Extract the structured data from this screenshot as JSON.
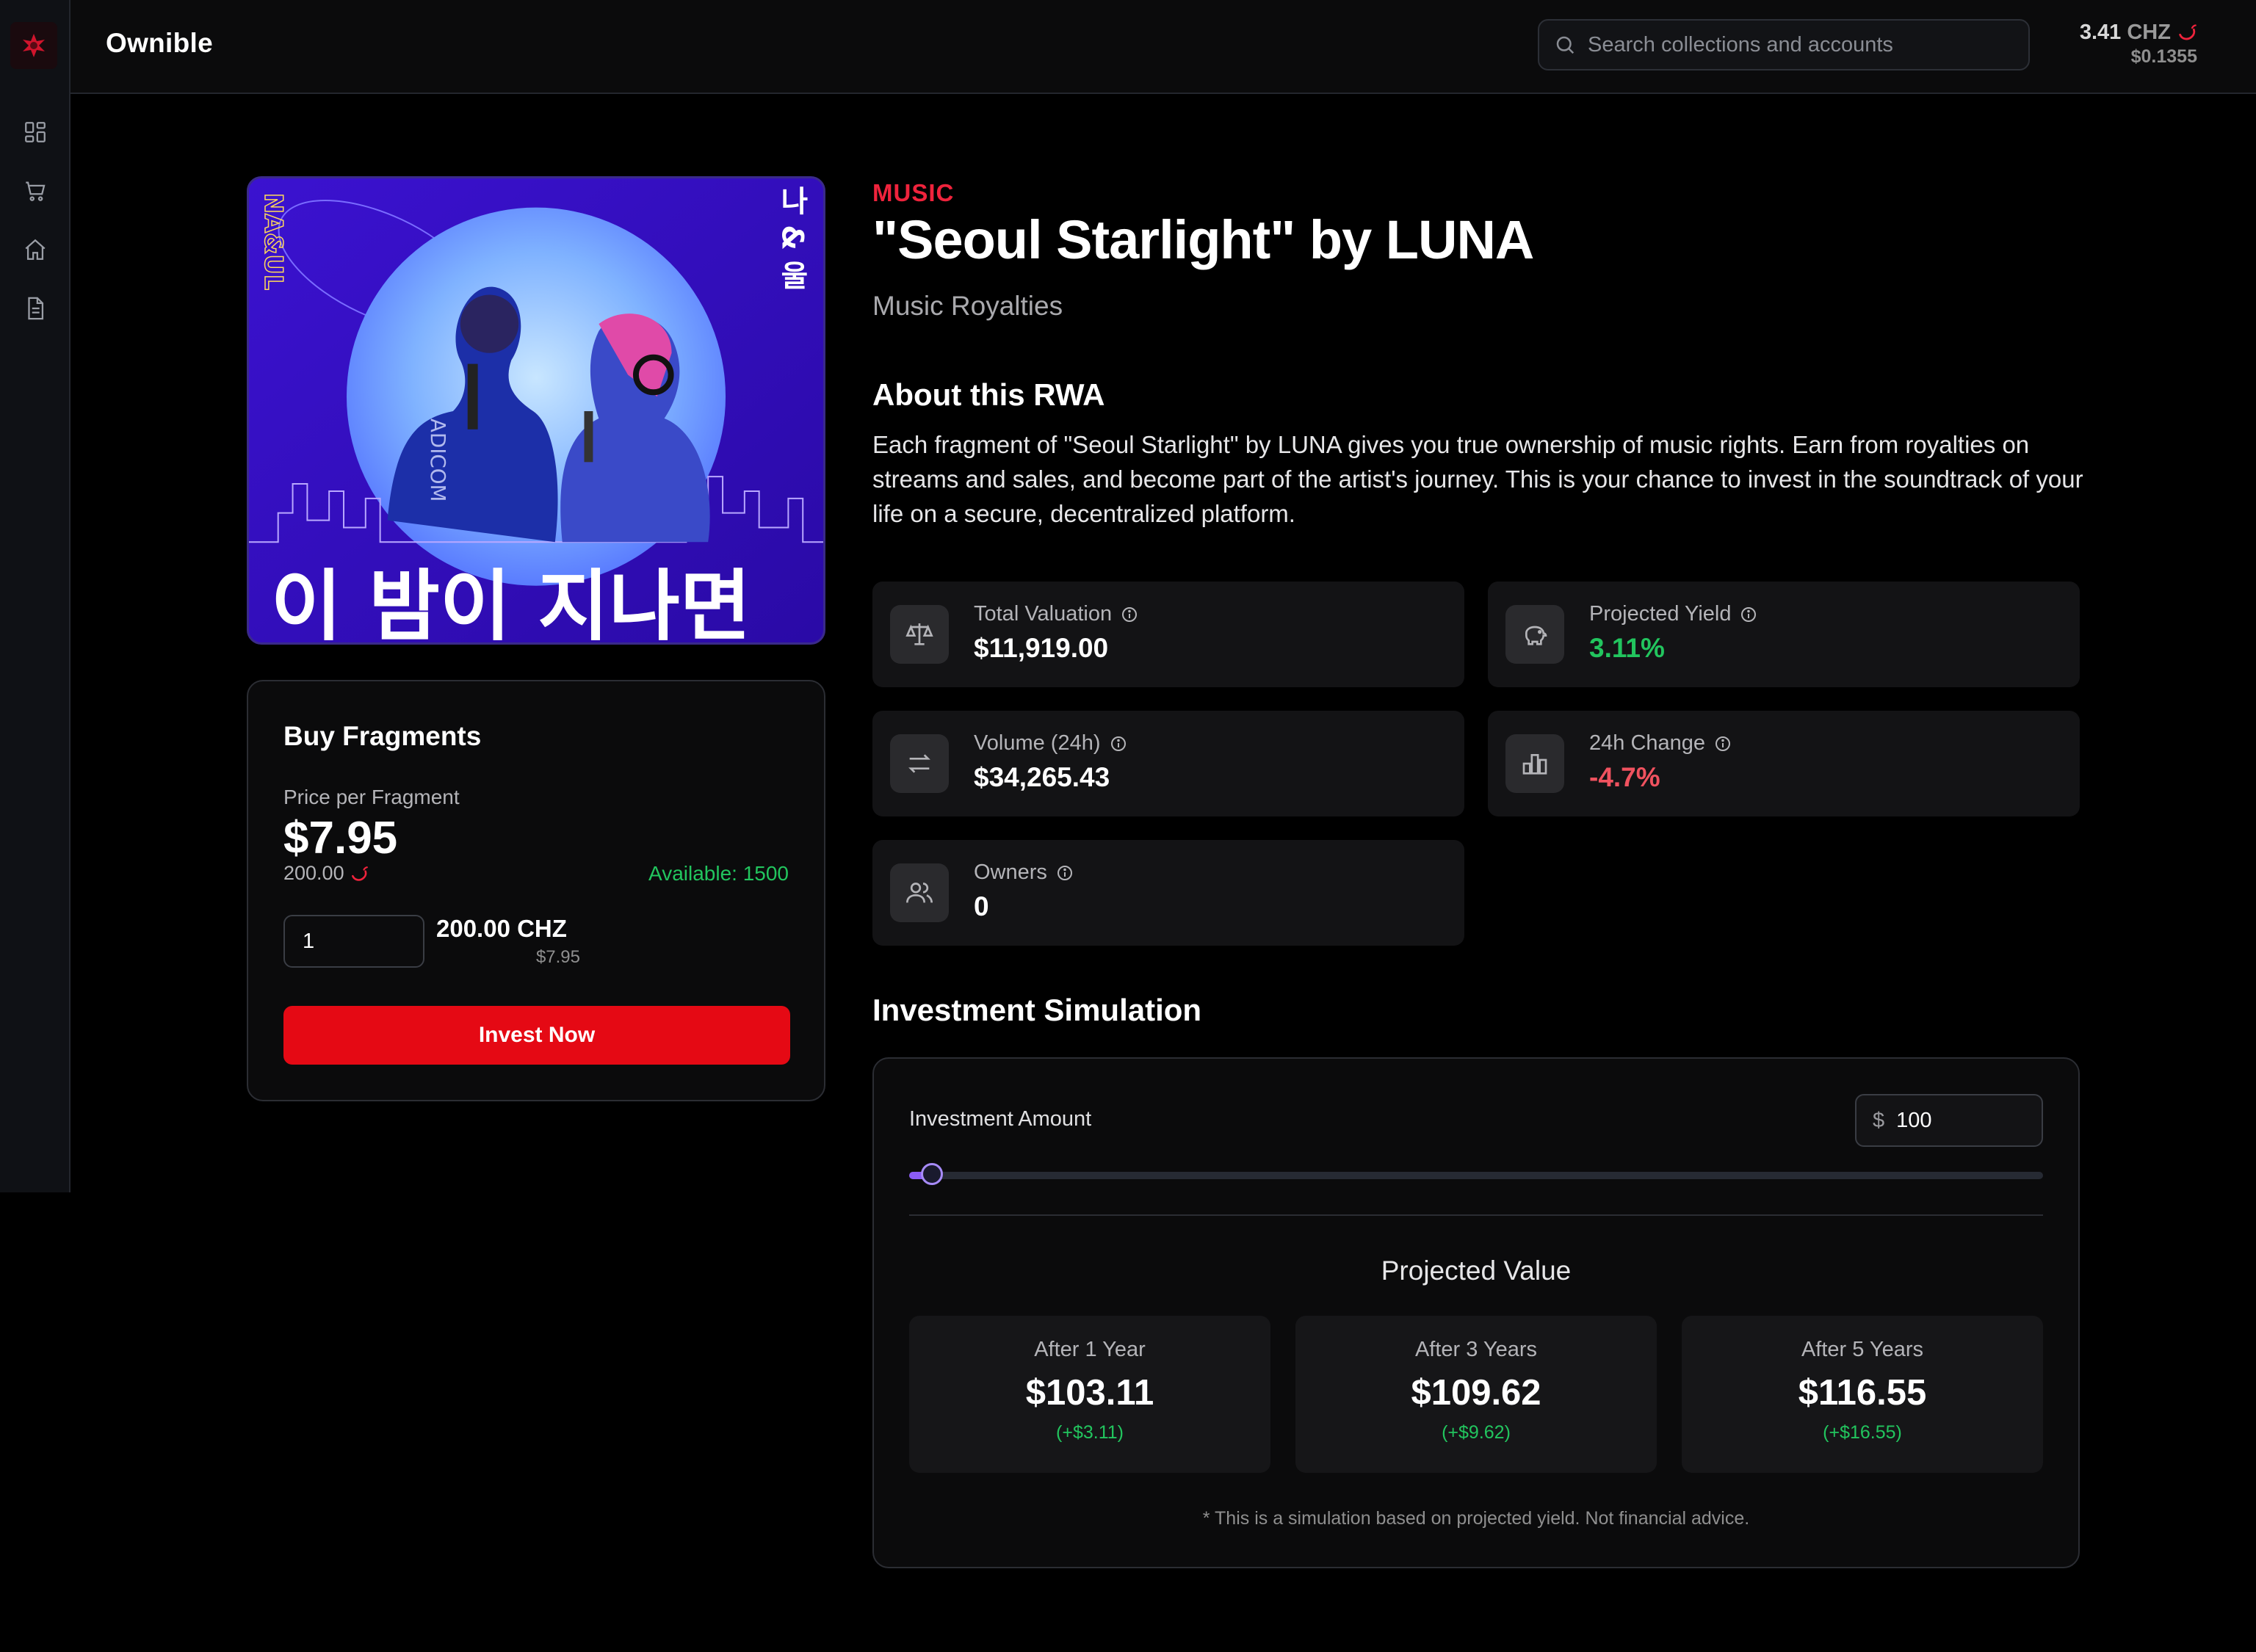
{
  "app": {
    "name": "Ownible"
  },
  "search": {
    "placeholder": "Search collections and accounts"
  },
  "wallet": {
    "chz_amount": "3.41",
    "chz_unit": "CHZ",
    "usd_value": "$0.1355"
  },
  "sidebar": {
    "icons": [
      "dashboard-icon",
      "cart-icon",
      "home-icon",
      "document-icon"
    ]
  },
  "album_art": {
    "band_text": "NA&UL",
    "side_text": "나 & 울",
    "vertical_text": "ADICOM",
    "title_text": "이 밤이 지나면"
  },
  "buy": {
    "title": "Buy Fragments",
    "price_label": "Price per Fragment",
    "price": "$7.95",
    "price_chz": "200.00",
    "available": "Available: 1500",
    "quantity": "1",
    "total_chz": "200.00 CHZ",
    "total_usd": "$7.95",
    "button": "Invest Now"
  },
  "asset": {
    "category": "MUSIC",
    "title": "\"Seoul Starlight\" by LUNA",
    "subtitle": "Music Royalties",
    "about_heading": "About this RWA",
    "about_text": "Each fragment of \"Seoul Starlight\" by LUNA gives you true ownership of music rights. Earn from royalties on streams and sales, and become part of the artist's journey. This is your chance to invest in the soundtrack of your life on a secure, decentralized platform."
  },
  "stats": {
    "total_valuation": {
      "label": "Total Valuation",
      "value": "$11,919.00"
    },
    "projected_yield": {
      "label": "Projected Yield",
      "value": "3.11%"
    },
    "volume": {
      "label": "Volume (24h)",
      "value": "$34,265.43"
    },
    "change": {
      "label": "24h Change",
      "value": "-4.7%"
    },
    "owners": {
      "label": "Owners",
      "value": "0"
    }
  },
  "simulation": {
    "heading": "Investment Simulation",
    "amount_label": "Investment Amount",
    "currency_symbol": "$",
    "amount": "100",
    "slider_fraction": 0.02,
    "projected_heading": "Projected Value",
    "projections": [
      {
        "label": "After 1 Year",
        "value": "$103.11",
        "gain": "(+$3.11)"
      },
      {
        "label": "After 3 Years",
        "value": "$109.62",
        "gain": "(+$9.62)"
      },
      {
        "label": "After 5 Years",
        "value": "$116.55",
        "gain": "(+$16.55)"
      }
    ],
    "disclaimer": "* This is a simulation based on projected yield. Not financial advice."
  },
  "colors": {
    "accent_red": "#e50914",
    "category_red": "#ef233c",
    "positive_green": "#22c55e",
    "negative_red": "#f0525f",
    "slider_purple": "#8b5cf6"
  }
}
